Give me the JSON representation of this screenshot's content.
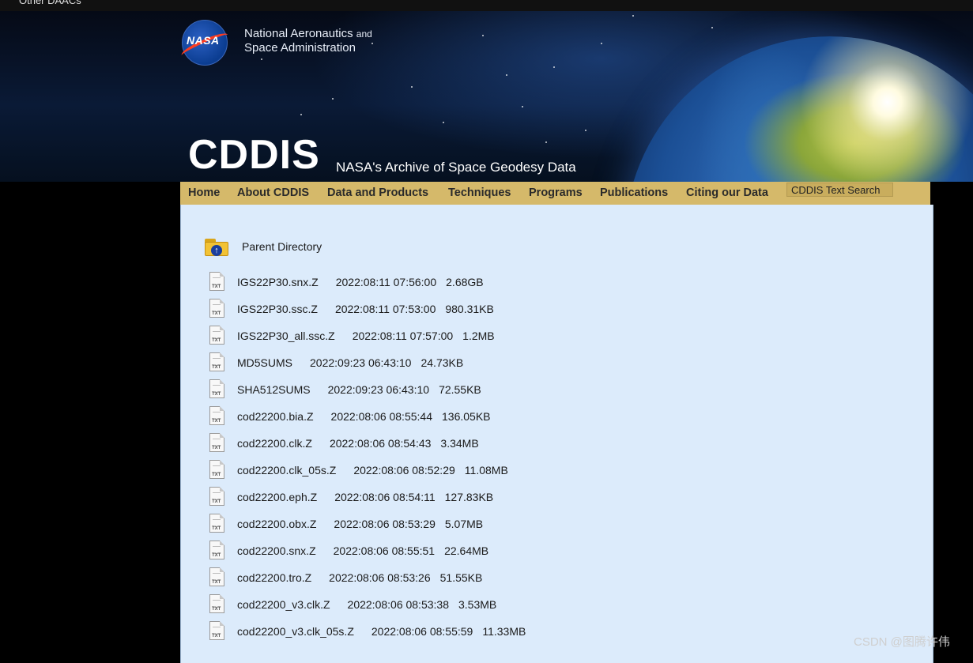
{
  "top_bar": {
    "text": "Other DAACs"
  },
  "header": {
    "agency_line1": "National Aeronautics",
    "agency_and": "and",
    "agency_line2": "Space Administration",
    "logo_text": "NASA",
    "site_title": "CDDIS",
    "site_subtitle": "NASA's Archive of Space Geodesy Data"
  },
  "nav": {
    "items": [
      "Home",
      "About CDDIS",
      "Data and Products",
      "Techniques",
      "Programs",
      "Publications",
      "Citing our Data"
    ],
    "search_label": "CDDIS Text Search"
  },
  "listing": {
    "parent_label": "Parent Directory",
    "files": [
      {
        "name": "IGS22P30.snx.Z",
        "date": "2022:08:11 07:56:00",
        "size": "2.68GB"
      },
      {
        "name": "IGS22P30.ssc.Z",
        "date": "2022:08:11 07:53:00",
        "size": "980.31KB"
      },
      {
        "name": "IGS22P30_all.ssc.Z",
        "date": "2022:08:11 07:57:00",
        "size": "1.2MB"
      },
      {
        "name": "MD5SUMS",
        "date": "2022:09:23 06:43:10",
        "size": "24.73KB"
      },
      {
        "name": "SHA512SUMS",
        "date": "2022:09:23 06:43:10",
        "size": "72.55KB"
      },
      {
        "name": "cod22200.bia.Z",
        "date": "2022:08:06 08:55:44",
        "size": "136.05KB"
      },
      {
        "name": "cod22200.clk.Z",
        "date": "2022:08:06 08:54:43",
        "size": "3.34MB"
      },
      {
        "name": "cod22200.clk_05s.Z",
        "date": "2022:08:06 08:52:29",
        "size": "11.08MB"
      },
      {
        "name": "cod22200.eph.Z",
        "date": "2022:08:06 08:54:11",
        "size": "127.83KB"
      },
      {
        "name": "cod22200.obx.Z",
        "date": "2022:08:06 08:53:29",
        "size": "5.07MB"
      },
      {
        "name": "cod22200.snx.Z",
        "date": "2022:08:06 08:55:51",
        "size": "22.64MB"
      },
      {
        "name": "cod22200.tro.Z",
        "date": "2022:08:06 08:53:26",
        "size": "51.55KB"
      },
      {
        "name": "cod22200_v3.clk.Z",
        "date": "2022:08:06 08:53:38",
        "size": "3.53MB"
      },
      {
        "name": "cod22200_v3.clk_05s.Z",
        "date": "2022:08:06 08:55:59",
        "size": "11.33MB"
      }
    ],
    "file_icon_label": "TXT"
  },
  "watermark": "CSDN @图腾许伟"
}
